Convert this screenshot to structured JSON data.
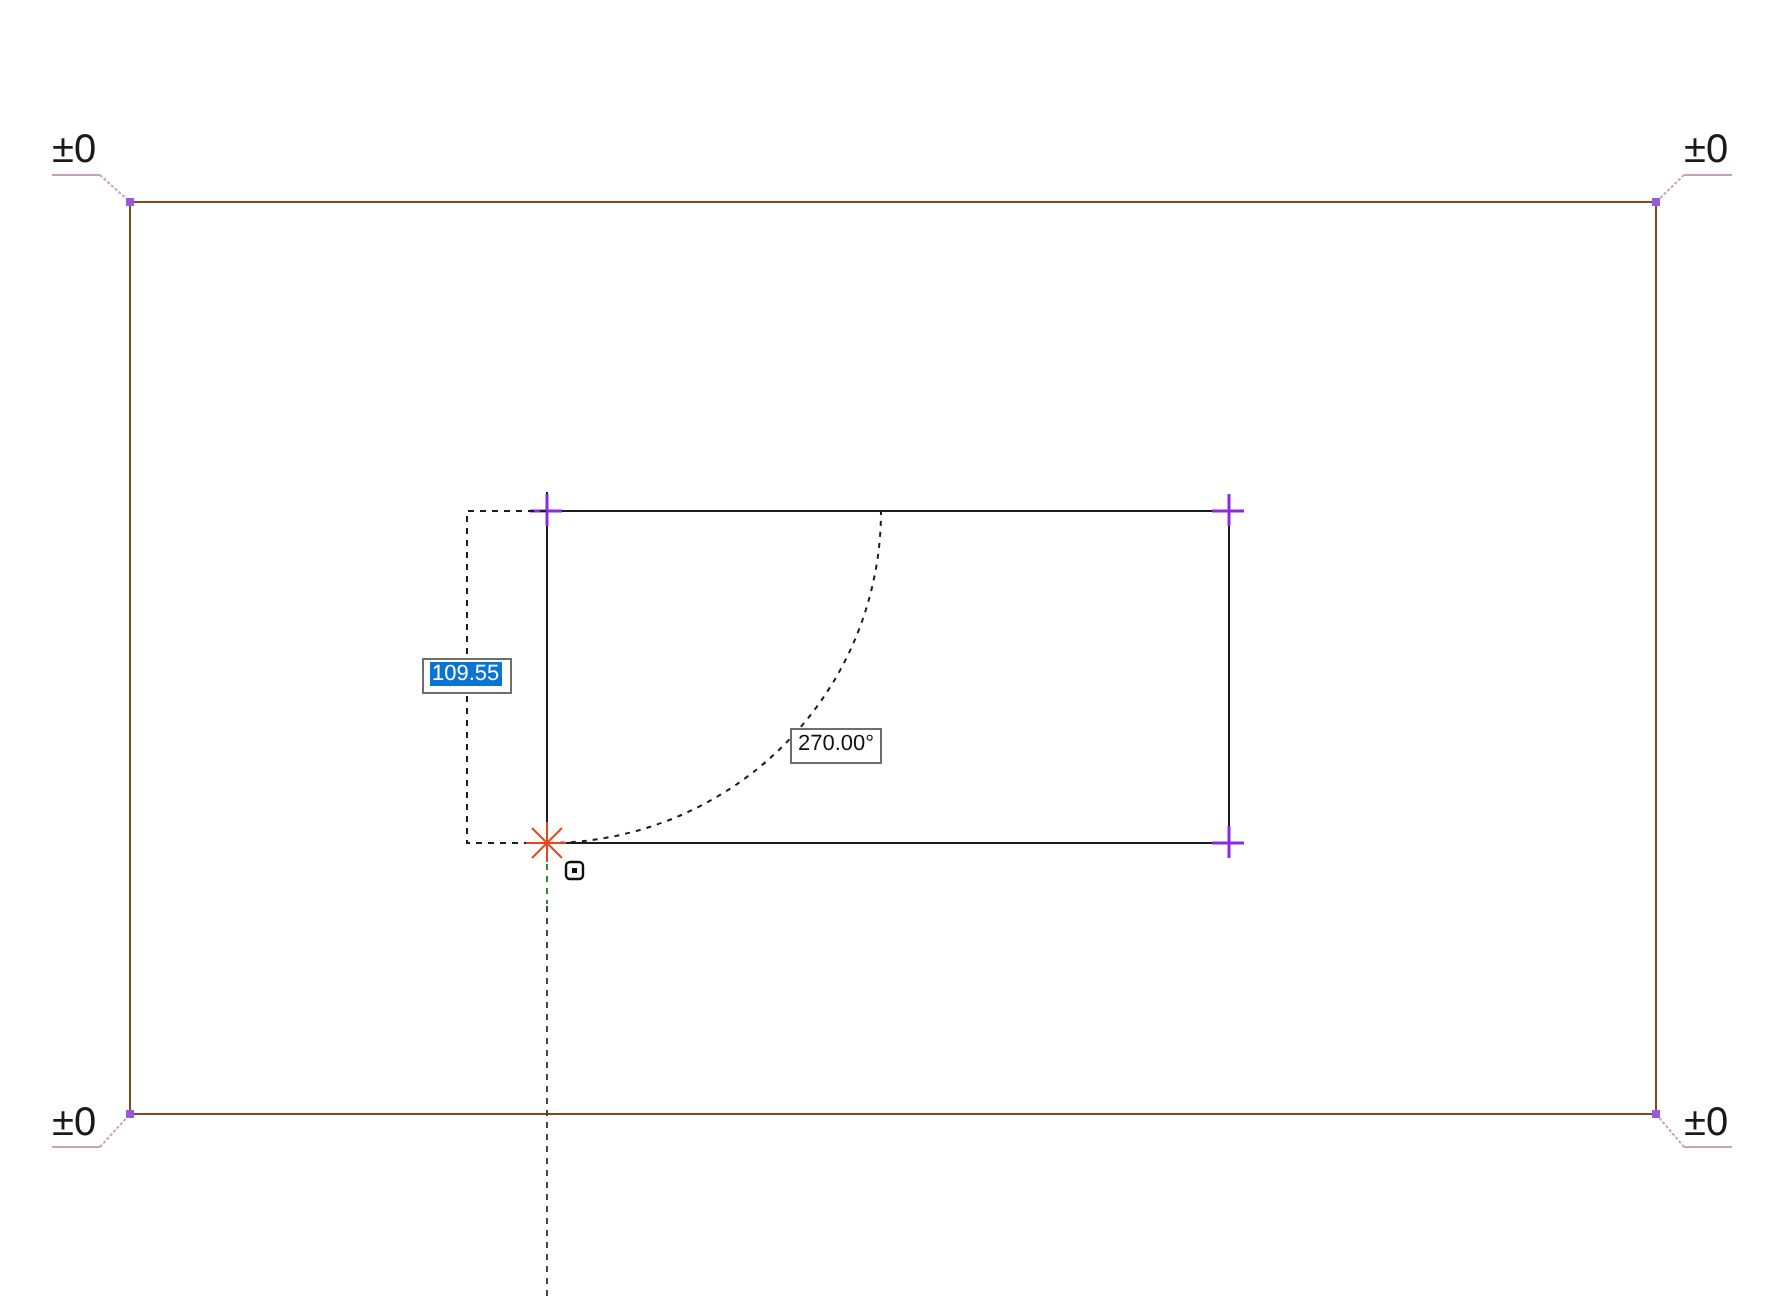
{
  "outer_rectangle": {
    "elevation_labels": [
      "±0",
      "±0",
      "±0",
      "±0"
    ]
  },
  "dimension_input": {
    "value": "109.55",
    "selected": true
  },
  "angle_input": {
    "value": "270.00°"
  }
}
